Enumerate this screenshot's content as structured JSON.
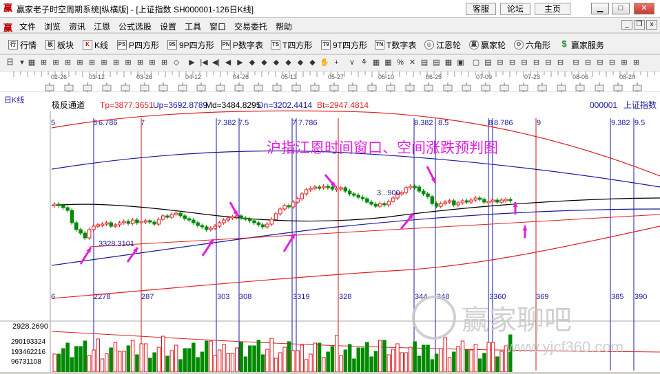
{
  "window": {
    "title": "赢家老子时空周期系统[纵横版] - [上证指数  SH000001-126日K线]",
    "right_buttons": [
      "客服",
      "论坛",
      "主页"
    ],
    "app_icon": "赢"
  },
  "menu": {
    "items": [
      "文件",
      "浏览",
      "资讯",
      "江恩",
      "公式选股",
      "设置",
      "工具",
      "窗口",
      "交易委托",
      "帮助"
    ]
  },
  "toolbar1": {
    "items": [
      {
        "icon": "行",
        "label": "行情"
      },
      {
        "icon": "板",
        "label": "板块"
      },
      {
        "icon": "K",
        "label": "K线"
      },
      {
        "icon": "PS",
        "label": "P四方形"
      },
      {
        "icon": "9S",
        "label": "9P四方形"
      },
      {
        "icon": "PN",
        "label": "P数字表"
      },
      {
        "icon": "TS",
        "label": "T四方形"
      },
      {
        "icon": "T9",
        "label": "9T四方形"
      },
      {
        "icon": "TN",
        "label": "T数字表"
      },
      {
        "icon": "◎",
        "label": "江恩轮"
      },
      {
        "icon": "赢",
        "label": "赢家轮"
      },
      {
        "icon": "❂",
        "label": "六角形"
      },
      {
        "icon": "$",
        "label": "赢家服务"
      }
    ]
  },
  "date_ruler": {
    "labels": [
      "02-26",
      "03-12",
      "03-26",
      "04-12",
      "04-26",
      "05-13",
      "05-27",
      "06-10",
      "06-25",
      "07-09",
      "07-23",
      "08-06",
      "08-20"
    ]
  },
  "chart_header": {
    "period": "日K线",
    "indicator": "极反通道",
    "tp": "Tp=3877.3651",
    "up": "Up=3692.8789",
    "md": "Md=3484.8295",
    "dn": "Dn=3202.4414",
    "bt": "Bt=2947.4814",
    "code": "000001",
    "name": "上证指数"
  },
  "annotation": {
    "text": "沪指江恩时间窗口、空间涨跌预判图",
    "price_low": "3328.3101",
    "price_high": "3...900"
  },
  "top_cycle_labels": [
    "5",
    "6",
    "6.786",
    "7",
    "7.382",
    "7.5",
    "7",
    "7.786",
    "8.382",
    "8.5",
    "8",
    "8.786",
    "9",
    "9.382",
    "9.5"
  ],
  "bottom_cycle_labels": [
    "6",
    "2278",
    "287",
    "303",
    "308",
    "3319",
    "328",
    "344",
    "348",
    "3360",
    "369",
    "385",
    "390"
  ],
  "volume_axis": {
    "price_marker": "2928.2690",
    "labels": [
      "290193324",
      "193462216",
      "96731108"
    ]
  },
  "watermark": {
    "text": "赢家聊吧",
    "url": "www.yjcf360.com"
  },
  "colors": {
    "up": "#e0161c",
    "down": "#008a00",
    "annotation": "#e020e0",
    "channel_outer": "#e02020",
    "channel_inner": "#1a1aa0",
    "cycle_blue": "#1a1aa0",
    "cycle_red": "#cc1010"
  }
}
